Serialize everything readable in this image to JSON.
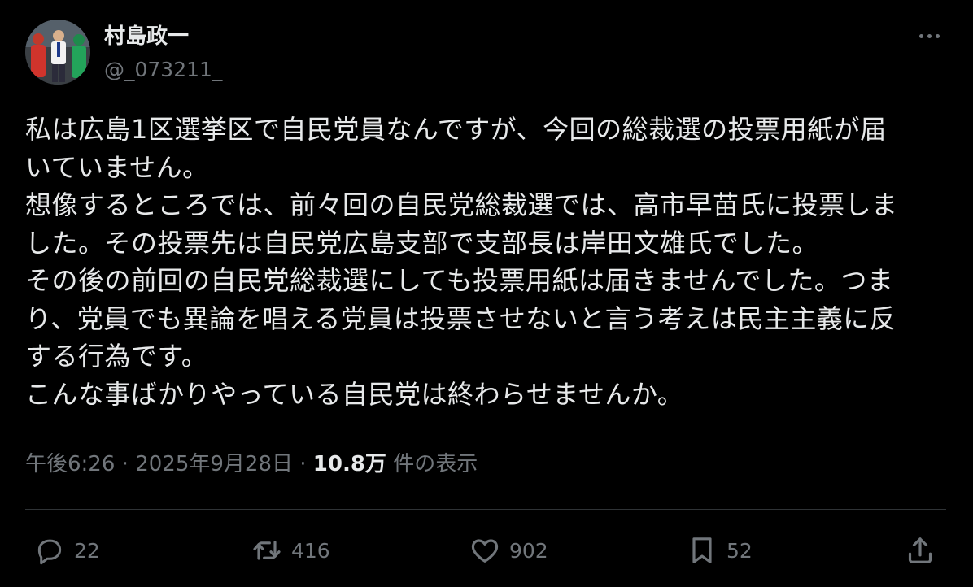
{
  "author": {
    "display_name": "村島政一",
    "handle": "@_073211_",
    "avatar_icon": "profile-photo"
  },
  "more_icon": "more-dots-icon",
  "body_lines": [
    "私は広島1区選挙区で自民党員なんですが、今回の総裁選の投票用紙が届",
    "いていません。",
    "想像するところでは、前々回の自民党総裁選では、高市早苗氏に投票しま",
    "した。その投票先は自民党広島支部で支部長は岸田文雄氏でした。",
    "その後の前回の自民党総裁選にしても投票用紙は届きませんでした。つま",
    "り、党員でも異論を唱える党員は投票させないと言う考えは民主主義に反",
    "する行為です。",
    "こんな事ばかりやっている自民党は終わらせませんか。"
  ],
  "meta": {
    "time": "午後6:26",
    "separator": " · ",
    "date": "2025年9月28日",
    "views_count": "10.8万",
    "views_label": " 件の表示"
  },
  "actions": {
    "reply_count": "22",
    "repost_count": "416",
    "like_count": "902",
    "bookmark_count": "52"
  },
  "colors": {
    "background": "#000000",
    "text_primary": "#e7e9ea",
    "text_secondary": "#71767b",
    "divider": "#2f3336"
  }
}
